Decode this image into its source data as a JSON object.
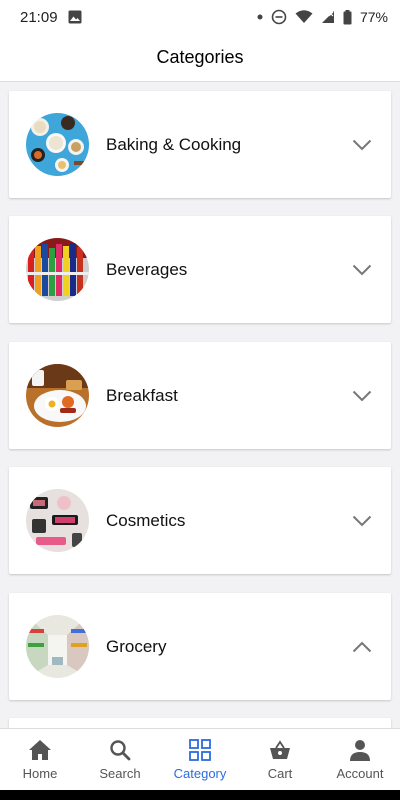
{
  "status_bar": {
    "time": "21:09",
    "battery": "77%"
  },
  "header": {
    "title": "Categories"
  },
  "categories": [
    {
      "label": "Baking & Cooking",
      "image_icon": "baking-ingredients-image",
      "expanded": false
    },
    {
      "label": "Beverages",
      "image_icon": "beverage-bottles-image",
      "expanded": false
    },
    {
      "label": "Breakfast",
      "image_icon": "breakfast-plate-image",
      "expanded": false
    },
    {
      "label": "Cosmetics",
      "image_icon": "cosmetics-products-image",
      "expanded": false
    },
    {
      "label": "Grocery",
      "image_icon": "grocery-aisle-image",
      "expanded": true
    }
  ],
  "bottom_nav": {
    "items": [
      {
        "label": "Home",
        "icon": "home-icon",
        "active": false
      },
      {
        "label": "Search",
        "icon": "search-icon",
        "active": false
      },
      {
        "label": "Category",
        "icon": "grid-icon",
        "active": true
      },
      {
        "label": "Cart",
        "icon": "basket-icon",
        "active": false
      },
      {
        "label": "Account",
        "icon": "person-icon",
        "active": false
      }
    ]
  },
  "colors": {
    "accent": "#2d6be0",
    "inactive": "#555555",
    "background": "#f2f2f4",
    "card": "#ffffff"
  }
}
